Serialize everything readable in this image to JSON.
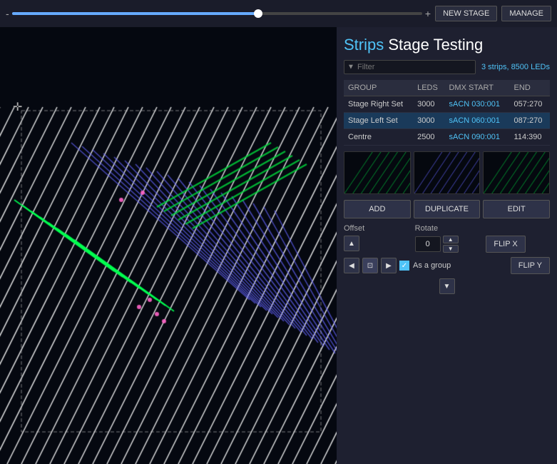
{
  "topbar": {
    "zoom_minus": "-",
    "zoom_plus": "+",
    "btn_new_stage": "NEW STAGE",
    "btn_manage": "MANAGE"
  },
  "stage": {
    "title_colored": "Strips",
    "title_rest": " Stage Testing",
    "filter_placeholder": "Filter",
    "strips_count": "3 strips, 8500 LEDs"
  },
  "table": {
    "headers": [
      "GROUP",
      "LEDS",
      "DMX START",
      "END"
    ],
    "rows": [
      {
        "group": "Stage Right Set",
        "leds": "3000",
        "dmx_start": "sACN 030:001",
        "end": "057:270",
        "selected": false
      },
      {
        "group": "Stage Left Set",
        "leds": "3000",
        "dmx_start": "sACN 060:001",
        "end": "087:270",
        "selected": true
      },
      {
        "group": "Centre",
        "leds": "2500",
        "dmx_start": "sACN 090:001",
        "end": "114:390",
        "selected": false
      }
    ]
  },
  "actions": {
    "add": "ADD",
    "duplicate": "DUPLICATE",
    "edit": "EDIT"
  },
  "offset": {
    "label": "Offset"
  },
  "rotate": {
    "label": "Rotate",
    "value": "0"
  },
  "controls": {
    "flip_x": "FLIP X",
    "flip_y": "FLIP Y",
    "as_group": "As a group"
  }
}
